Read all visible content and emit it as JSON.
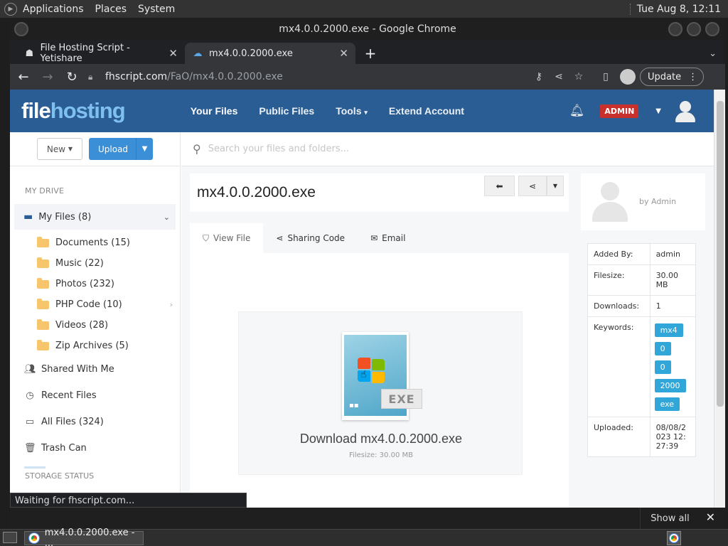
{
  "os": {
    "menus": [
      "Applications",
      "Places",
      "System"
    ],
    "clock": "Tue Aug  8, 12:11"
  },
  "window": {
    "title": "mx4.0.0.2000.exe - Google Chrome"
  },
  "browser": {
    "tabs": [
      {
        "label": "File Hosting Script - Yetishare",
        "icon": "ghost-icon"
      },
      {
        "label": "mx4.0.0.2000.exe",
        "icon": "cloud-icon"
      }
    ],
    "url_host": "fhscript.com",
    "url_path": "/FaO/mx4.0.0.2000.exe",
    "update_label": "Update"
  },
  "site": {
    "logo_a": "file",
    "logo_b": "hosting",
    "nav": [
      "Your Files",
      "Public Files",
      "Tools",
      "Extend Account"
    ],
    "admin_badge": "ADMIN",
    "search_placeholder": "Search your files and folders..."
  },
  "sidebar": {
    "new_label": "New",
    "upload_label": "Upload",
    "section_title": "MY DRIVE",
    "my_files": "My Files (8)",
    "folders": [
      "Documents (15)",
      "Music (22)",
      "Photos (232)",
      "PHP Code (10)",
      "Videos (28)",
      "Zip Archives (5)"
    ],
    "links": [
      "Shared With Me",
      "Recent Files",
      "All Files (324)",
      "Trash Can"
    ],
    "storage_title": "STORAGE STATUS"
  },
  "file": {
    "name": "mx4.0.0.2000.exe",
    "tabs": [
      "View File",
      "Sharing Code",
      "Email"
    ],
    "download_label": "Download mx4.0.0.2000.exe",
    "filesize_label": "Filesize: 30.00 MB",
    "ext_tag": "EXE",
    "owner": "by Admin"
  },
  "info": {
    "added_by_k": "Added By:",
    "added_by_v": "admin",
    "filesize_k": "Filesize:",
    "filesize_v": "30.00 MB",
    "downloads_k": "Downloads:",
    "downloads_v": "1",
    "keywords_k": "Keywords:",
    "keywords": [
      "mx4",
      "0",
      "0",
      "2000",
      "exe"
    ],
    "uploaded_k": "Uploaded:",
    "uploaded_v": "08/08/2023 12:27:39"
  },
  "status_text": "Waiting for fhscript.com...",
  "downloads_bar": {
    "show_all": "Show all"
  },
  "taskbar": {
    "item": "mx4.0.0.2000.exe - ..."
  },
  "colors": {
    "nav_bg": "#2a5d93",
    "upload_btn": "#3a8fd6",
    "admin_badge": "#c9302c",
    "keyword_tag": "#31a6d8"
  }
}
